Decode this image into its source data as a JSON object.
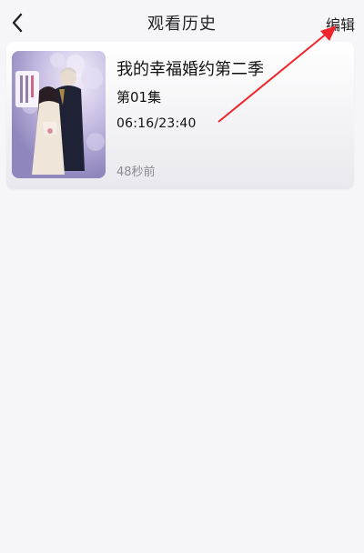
{
  "header": {
    "title": "观看历史",
    "edit_label": "编辑",
    "back_icon": "chevron-left-icon"
  },
  "history": [
    {
      "title": "我的幸福婚约第二季",
      "episode": "第01集",
      "progress_text": "06:16/23:40",
      "watched_ago": "48秒前",
      "cover_logo_text": "わたしの幸せな結婚"
    }
  ],
  "annotation": {
    "arrow_color": "#f0252b"
  }
}
